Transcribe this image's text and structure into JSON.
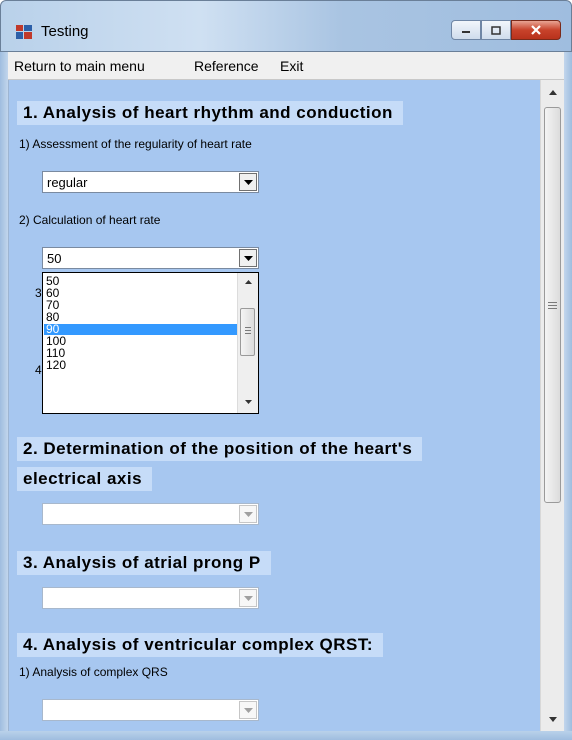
{
  "window": {
    "title": "Testing",
    "icons": [
      "app-icon",
      "minimize-icon",
      "maximize-icon",
      "close-icon"
    ]
  },
  "menu": {
    "items": [
      "Return to main menu",
      "Reference",
      "Exit"
    ]
  },
  "section1": {
    "heading": "1. Analysis of heart rhythm and conduction",
    "q1_label": "1) Assessment of the regularity of heart rate",
    "q1_value": "regular",
    "q2_label": "2) Calculation of heart rate",
    "q2_value": "50",
    "q2_options": [
      "50",
      "60",
      "70",
      "80",
      "90",
      "100",
      "110",
      "120"
    ],
    "q2_highlighted": "90",
    "hidden_label_3_fragment": "3",
    "hidden_label_4_fragment": "4"
  },
  "section2": {
    "heading_line1": "2. Determination of the position of the heart's",
    "heading_line2": "electrical axis",
    "value": ""
  },
  "section3": {
    "heading": "3. Analysis of atrial prong P",
    "value": ""
  },
  "section4": {
    "heading": "4. Analysis of ventricular complex QRST:",
    "q1_label": "1) Analysis of complex QRS",
    "q1_value": ""
  },
  "colors": {
    "content_bg": "#a7c7f0",
    "heading_bg": "#c6dcf8",
    "selection": "#3399ff",
    "close_button": "#c8432b"
  }
}
